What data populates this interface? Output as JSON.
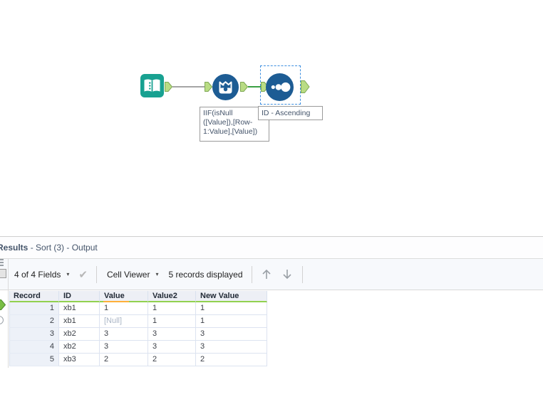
{
  "workflow": {
    "annotations": {
      "formula": {
        "full_text": "IIF(isNull ([Value]),[Row-1:Value],[Value])",
        "line1": "IIF(isNull",
        "line2": "([Value]),[Row-",
        "line3": "1:Value],[Value])"
      },
      "sort": "ID - Ascending"
    },
    "icons": {
      "input_tool_icon": "open-book",
      "formula_tool_icon": "beaker-with-drops",
      "sort_tool_icon": "ascending-dots"
    }
  },
  "results": {
    "title": {
      "bold": "Results",
      "rest": " - Sort (3) - Output"
    },
    "toolbar": {
      "fields": "4 of 4 Fields",
      "caret": "▾",
      "check": "✔",
      "cell_viewer": "Cell Viewer",
      "records": "5 records displayed"
    },
    "table": {
      "columns": [
        "Record",
        "ID",
        "Value",
        "Value2",
        "New Value"
      ],
      "rows": [
        [
          "1",
          "xb1",
          "1",
          "1",
          "1"
        ],
        [
          "2",
          "xb1",
          "[Null]",
          "1",
          "1"
        ],
        [
          "3",
          "xb2",
          "3",
          "3",
          "3"
        ],
        [
          "4",
          "xb2",
          "3",
          "3",
          "3"
        ],
        [
          "5",
          "xb3",
          "2",
          "2",
          "2"
        ]
      ],
      "null_literal": "[Null]"
    }
  },
  "colors": {
    "tool_blue": "#1d5c94",
    "tool_teal": "#18a191",
    "anchor_fill": "#b9dc84",
    "anchor_border": "#7fa855",
    "connection_green": "#3aa044",
    "connection_gray": "#a6a6a6",
    "selection_blue": "#3d8fe0",
    "header_underline_green": "#92d14f",
    "header_underline_orange": "#ffb03a",
    "title_text": "#44546a"
  }
}
